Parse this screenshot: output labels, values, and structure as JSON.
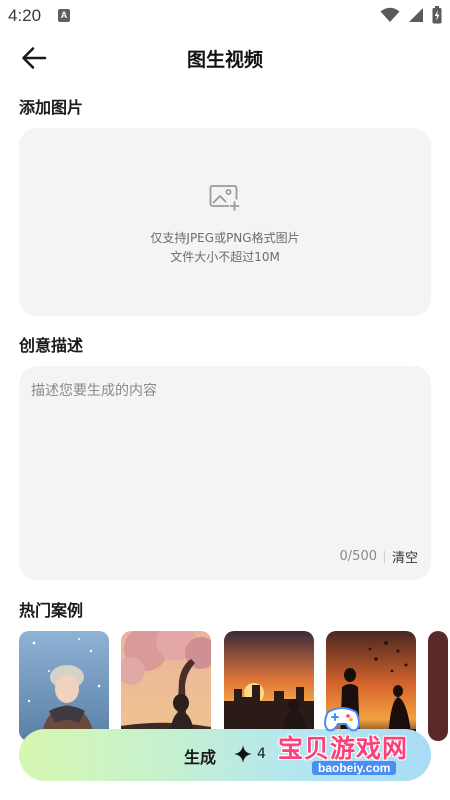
{
  "status_bar": {
    "time": "4:20",
    "indicator": "A"
  },
  "header": {
    "title": "图生视频"
  },
  "upload": {
    "section_title": "添加图片",
    "hint_line1": "仅支持JPEG或PNG格式图片",
    "hint_line2": "文件大小不超过10M"
  },
  "description": {
    "section_title": "创意描述",
    "placeholder": "描述您要生成的内容",
    "char_count": "0/500",
    "clear_label": "清空"
  },
  "cases": {
    "section_title": "热门案例",
    "items": [
      {
        "scene": "winter girl in snow"
      },
      {
        "scene": "girl under cherry blossom tree"
      },
      {
        "scene": "city sunset with figures"
      },
      {
        "scene": "sunset couple with flying petals"
      }
    ]
  },
  "generate": {
    "label": "生成",
    "cost": "4",
    "icon": "sparkle-icon"
  },
  "watermark": {
    "text": "宝贝游戏网",
    "url": "baobeiy.com"
  },
  "colors": {
    "accent_start": "#d6f7b0",
    "accent_end": "#a9dcf6",
    "watermark": "#ff3f7a"
  }
}
